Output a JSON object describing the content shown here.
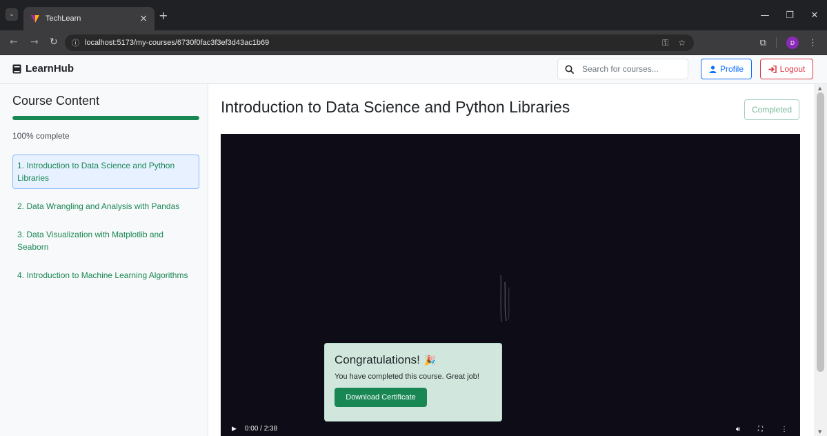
{
  "browser": {
    "tab_title": "TechLearn",
    "tab_close": "×",
    "new_tab": "+",
    "url": "localhost:5173/my-courses/6730f0fac3f3ef3d43ac1b69",
    "profile_initial": "D"
  },
  "navbar": {
    "brand": "LearnHub",
    "search_placeholder": "Search for courses...",
    "profile_label": "Profile",
    "logout_label": "Logout"
  },
  "sidebar": {
    "title": "Course Content",
    "progress_fraction": 1.0,
    "progress_label": "100% complete",
    "lessons": [
      {
        "label": "1. Introduction to Data Science and Python Libraries",
        "active": true
      },
      {
        "label": "2. Data Wrangling and Analysis with Pandas",
        "active": false
      },
      {
        "label": "3. Data Visualization with Matplotlib and Seaborn",
        "active": false
      },
      {
        "label": "4. Introduction to Machine Learning Algorithms",
        "active": false
      }
    ]
  },
  "main": {
    "course_title": "Introduction to Data Science and Python Libraries",
    "status_badge": "Completed",
    "video": {
      "time": "0:00 / 2:38"
    }
  },
  "congrats": {
    "title": "Congratulations!",
    "message": "You have completed this course. Great job!",
    "button_label": "Download Certificate"
  },
  "colors": {
    "success": "#198754",
    "primary": "#0d6efd",
    "danger": "#dc3545",
    "video_bg": "#0e0d17"
  }
}
